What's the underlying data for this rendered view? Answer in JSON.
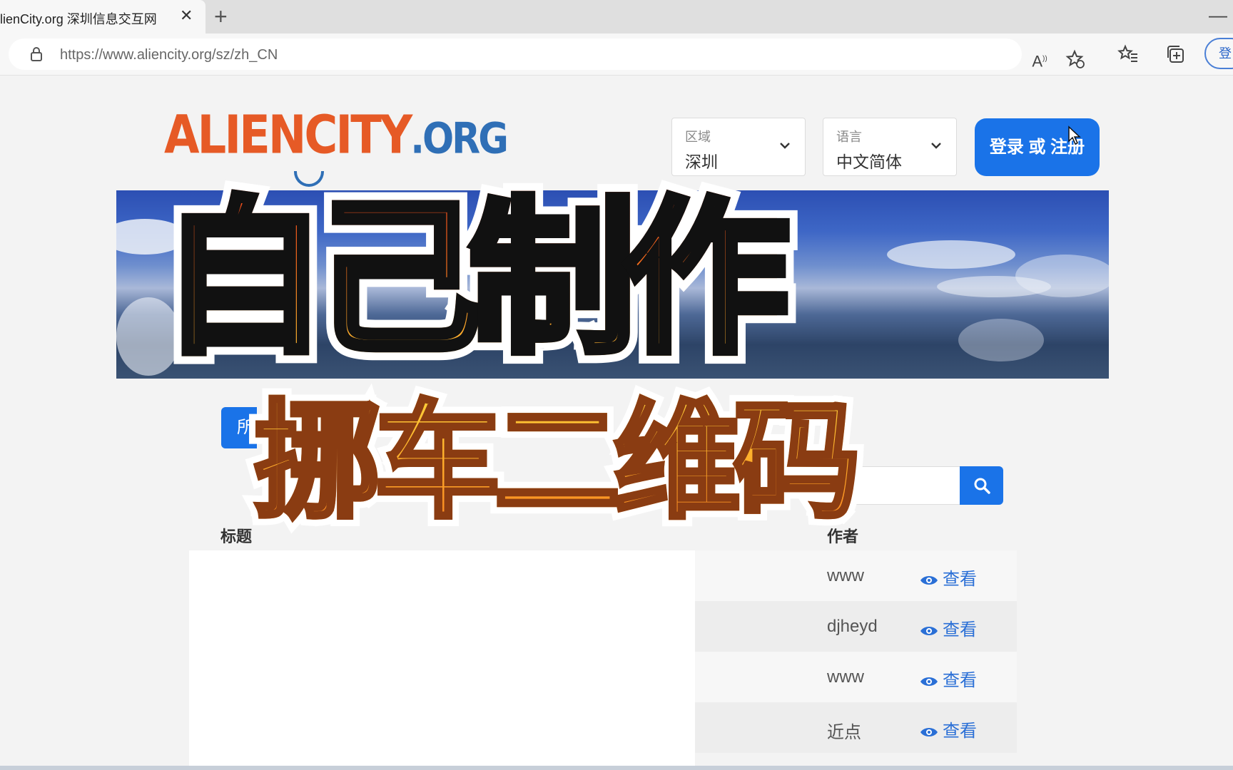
{
  "browser": {
    "tab_title": "lienCity.org 深圳信息交互网",
    "tab_close": "✕",
    "new_tab": "+",
    "minimize": "—",
    "url": "https://www.aliencity.org/sz/zh_CN",
    "signin_label": "登",
    "toolbar_icons": [
      "read-aloud-icon",
      "add-favorite-icon",
      "favorites-icon",
      "collections-icon"
    ]
  },
  "site": {
    "logo_main": "ALIENCITY",
    "logo_suffix": ".ORG",
    "region": {
      "label": "区域",
      "value": "深圳"
    },
    "language": {
      "label": "语言",
      "value": "中文简体"
    },
    "login_button": "登录 或 注册"
  },
  "overlay": {
    "line1": "自己制作",
    "line2": "挪车二维码"
  },
  "search": {
    "category_button": "所"
  },
  "table": {
    "headers": {
      "title": "标题",
      "author": "作者"
    },
    "rows": [
      {
        "author": "www",
        "action": "查看"
      },
      {
        "author": "djheyd",
        "action": "查看"
      },
      {
        "author": "www",
        "action": "查看"
      },
      {
        "author": "近点",
        "action": "查看"
      }
    ]
  },
  "colors": {
    "accent": "#1a73e8",
    "logo_orange": "#e65a26",
    "logo_blue": "#2f6fb6"
  }
}
